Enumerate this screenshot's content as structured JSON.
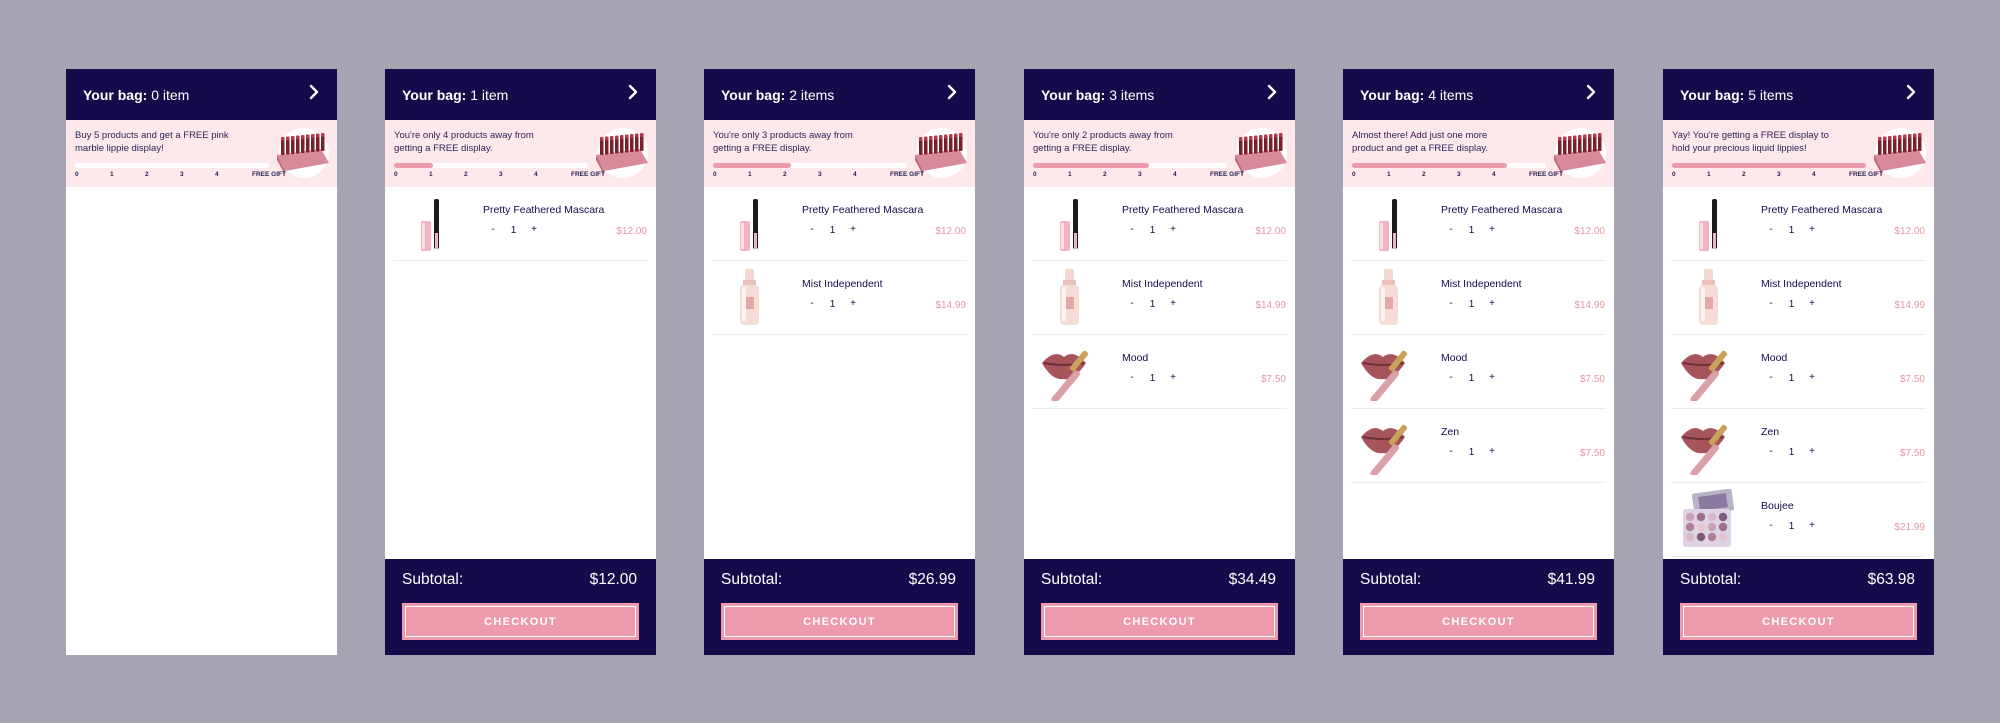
{
  "common": {
    "bag_label": "Your bag:",
    "subtotal_label": "Subtotal:",
    "checkout_label": "CHECKOUT",
    "tick_labels": [
      "0",
      "1",
      "2",
      "3",
      "4",
      "FREE GIFT"
    ],
    "colors": {
      "background": "#a6a3b3",
      "header": "#150b4b",
      "promo": "#fde8ec",
      "accent_pink": "#ec9aac",
      "price_pink": "#e596a8"
    },
    "icons": [
      "chevron-right-icon",
      "gift-display-icon",
      "mascara-icon",
      "mist-bottle-icon",
      "lips-gloss-icon",
      "eyeshadow-palette-icon"
    ]
  },
  "panels": [
    {
      "count_text": "0 item",
      "promo_text": "Buy 5 products and get a FREE pink marble lippie display!",
      "progress_fraction": 0,
      "items": [],
      "subtotal": null
    },
    {
      "count_text": "1 item",
      "promo_text": "You're only 4 products away from getting a FREE display.",
      "progress_fraction": 0.2,
      "items": [
        {
          "name": "Pretty Feathered Mascara",
          "qty": "1",
          "price": "$12.00",
          "icon": "mascara-icon"
        }
      ],
      "subtotal": "$12.00"
    },
    {
      "count_text": "2 items",
      "promo_text": "You're only 3 products away from getting a FREE display.",
      "progress_fraction": 0.4,
      "items": [
        {
          "name": "Pretty Feathered Mascara",
          "qty": "1",
          "price": "$12.00",
          "icon": "mascara-icon"
        },
        {
          "name": "Mist Independent",
          "qty": "1",
          "price": "$14.99",
          "icon": "mist-bottle-icon"
        }
      ],
      "subtotal": "$26.99"
    },
    {
      "count_text": "3 items",
      "promo_text": "You're only 2 products away from getting a FREE display.",
      "progress_fraction": 0.6,
      "items": [
        {
          "name": "Pretty Feathered Mascara",
          "qty": "1",
          "price": "$12.00",
          "icon": "mascara-icon"
        },
        {
          "name": "Mist Independent",
          "qty": "1",
          "price": "$14.99",
          "icon": "mist-bottle-icon"
        },
        {
          "name": "Mood",
          "qty": "1",
          "price": "$7.50",
          "icon": "lips-gloss-icon"
        }
      ],
      "subtotal": "$34.49"
    },
    {
      "count_text": "4 items",
      "promo_text": "Almost there! Add just one more product and get a FREE display.",
      "progress_fraction": 0.8,
      "items": [
        {
          "name": "Pretty Feathered Mascara",
          "qty": "1",
          "price": "$12.00",
          "icon": "mascara-icon"
        },
        {
          "name": "Mist Independent",
          "qty": "1",
          "price": "$14.99",
          "icon": "mist-bottle-icon"
        },
        {
          "name": "Mood",
          "qty": "1",
          "price": "$7.50",
          "icon": "lips-gloss-icon"
        },
        {
          "name": "Zen",
          "qty": "1",
          "price": "$7.50",
          "icon": "lips-gloss-icon"
        }
      ],
      "subtotal": "$41.99"
    },
    {
      "count_text": "5 items",
      "promo_text": "Yay! You're getting a FREE display to hold your precious liquid lippies!",
      "progress_fraction": 1.0,
      "items": [
        {
          "name": "Pretty Feathered Mascara",
          "qty": "1",
          "price": "$12.00",
          "icon": "mascara-icon"
        },
        {
          "name": "Mist Independent",
          "qty": "1",
          "price": "$14.99",
          "icon": "mist-bottle-icon"
        },
        {
          "name": "Mood",
          "qty": "1",
          "price": "$7.50",
          "icon": "lips-gloss-icon"
        },
        {
          "name": "Zen",
          "qty": "1",
          "price": "$7.50",
          "icon": "lips-gloss-icon"
        },
        {
          "name": "Boujee",
          "qty": "1",
          "price": "$21.99",
          "icon": "eyeshadow-palette-icon"
        }
      ],
      "subtotal": "$63.98"
    }
  ]
}
